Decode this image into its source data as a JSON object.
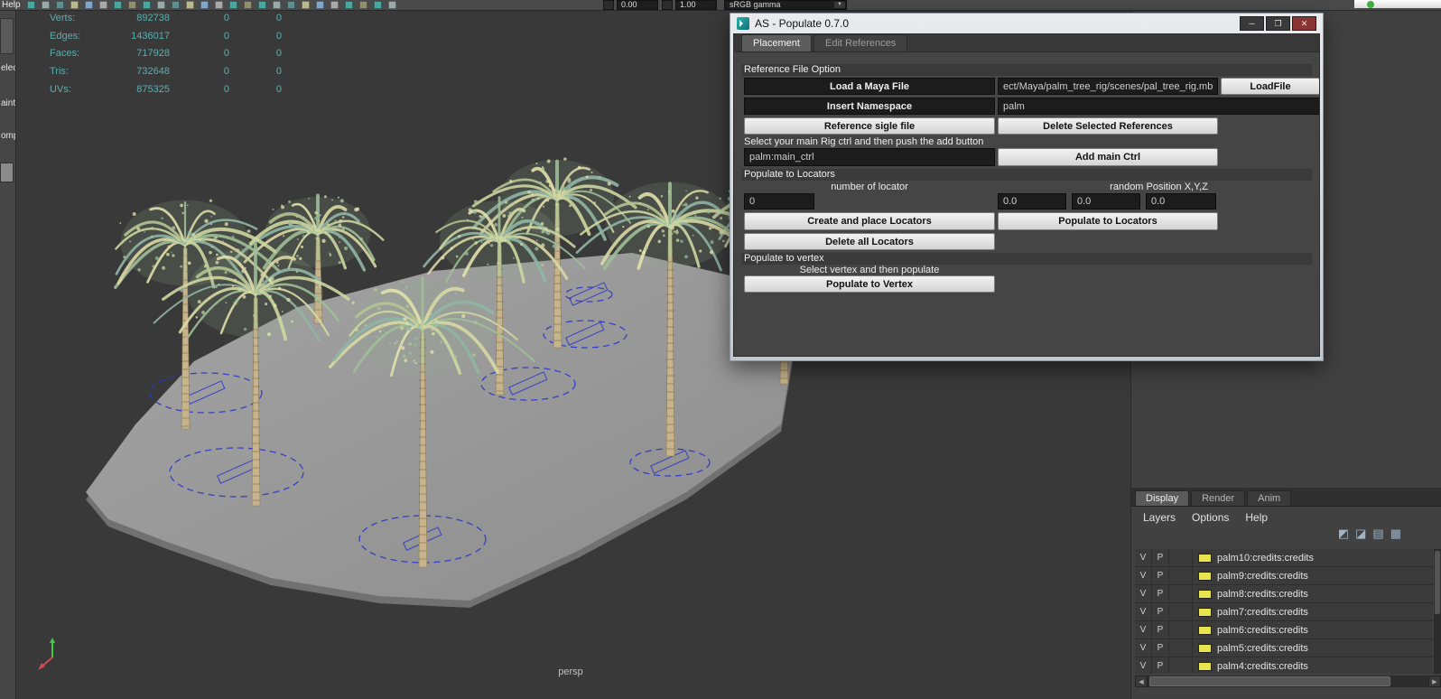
{
  "topbar": {
    "help_label": "Help",
    "exposure_value": "0.00",
    "gamma_value": "1.00",
    "view_transform": "sRGB gamma"
  },
  "left_panel_fragments": {
    "f2": "electi",
    "f3": "aint s",
    "f4": "ompo"
  },
  "hud": {
    "rows": [
      {
        "label": "Verts:",
        "v1": "892738",
        "v2": "0",
        "v3": "0"
      },
      {
        "label": "Edges:",
        "v1": "1436017",
        "v2": "0",
        "v3": "0"
      },
      {
        "label": "Faces:",
        "v1": "717928",
        "v2": "0",
        "v3": "0"
      },
      {
        "label": "Tris:",
        "v1": "732648",
        "v2": "0",
        "v3": "0"
      },
      {
        "label": "UVs:",
        "v1": "875325",
        "v2": "0",
        "v3": "0"
      }
    ]
  },
  "viewport": {
    "camera_label": "persp"
  },
  "dialog": {
    "title": "AS - Populate 0.7.0",
    "tabs": {
      "placement": "Placement",
      "edit_references": "Edit References"
    },
    "reference_section": {
      "header": "Reference File Option",
      "load_file_label": "Load a Maya File",
      "file_path_value": "ect/Maya/palm_tree_rig/scenes/pal_tree_rig.mb",
      "load_file_button": "LoadFile",
      "namespace_label": "Insert Namespace",
      "namespace_value": "palm",
      "reference_single_button": "Reference sigle file",
      "delete_references_button": "Delete Selected References"
    },
    "rig_section": {
      "instruction": "Select your main Rig ctrl and then push the add button",
      "main_ctrl_value": "palm:main_ctrl",
      "add_main_ctrl_button": "Add main Ctrl"
    },
    "locators_section": {
      "header": "Populate to Locators",
      "number_label": "number of locator",
      "random_label": "random Position X,Y,Z",
      "number_value": "0",
      "random_x": "0.0",
      "random_y": "0.0",
      "random_z": "0.0",
      "create_button": "Create and place Locators",
      "populate_button": "Populate to Locators",
      "delete_button": "Delete all Locators"
    },
    "vertex_section": {
      "header": "Populate to vertex",
      "instruction": "Select vertex and then populate",
      "populate_button": "Populate to Vertex"
    }
  },
  "layer_editor": {
    "tabs": {
      "display": "Display",
      "render": "Render",
      "anim": "Anim"
    },
    "menu": {
      "layers": "Layers",
      "options": "Options",
      "help": "Help"
    },
    "swatch_color": "#e8e34e",
    "rows": [
      {
        "v": "V",
        "p": "P",
        "name": "palm10:credits:credits"
      },
      {
        "v": "V",
        "p": "P",
        "name": "palm9:credits:credits"
      },
      {
        "v": "V",
        "p": "P",
        "name": "palm8:credits:credits"
      },
      {
        "v": "V",
        "p": "P",
        "name": "palm7:credits:credits"
      },
      {
        "v": "V",
        "p": "P",
        "name": "palm6:credits:credits"
      },
      {
        "v": "V",
        "p": "P",
        "name": "palm5:credits:credits"
      },
      {
        "v": "V",
        "p": "P",
        "name": "palm4:credits:credits"
      }
    ]
  }
}
